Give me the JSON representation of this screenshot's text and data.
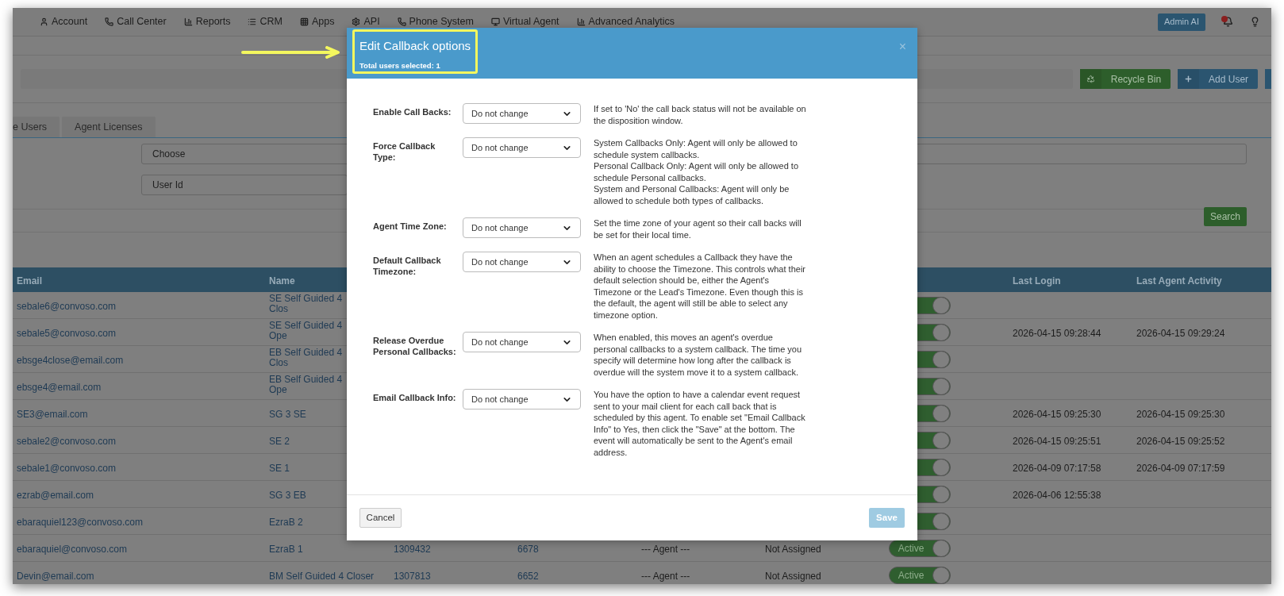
{
  "nav": {
    "items": [
      {
        "label": "Account",
        "kind": "user"
      },
      {
        "label": "Call Center",
        "kind": "phone"
      },
      {
        "label": "Reports",
        "kind": "chart"
      },
      {
        "label": "CRM",
        "kind": "list"
      },
      {
        "label": "Apps",
        "kind": "grid"
      },
      {
        "label": "API",
        "kind": "gear"
      },
      {
        "label": "Phone System",
        "kind": "phone"
      },
      {
        "label": "Virtual Agent",
        "kind": "monitor"
      },
      {
        "label": "Advanced Analytics",
        "kind": "chart"
      }
    ],
    "admin_button": "Admin AI"
  },
  "toolbar": {
    "buttons": [
      {
        "label": "Recycle Bin",
        "kind": "recycle"
      },
      {
        "label": "Add User",
        "kind": "add"
      }
    ]
  },
  "tabs": [
    {
      "label": "e Users",
      "selected": false
    },
    {
      "label": "Agent Licenses",
      "selected": false
    }
  ],
  "filters": {
    "select": "Choose",
    "field": "User Id",
    "search_button": "Search"
  },
  "table": {
    "columns": [
      {
        "label": "Email",
        "kind": "email"
      },
      {
        "label": "Name",
        "kind": "name"
      },
      {
        "label": "Last Login",
        "kind": "last_login"
      },
      {
        "label": "Last Agent Activity",
        "kind": "last_activity"
      }
    ],
    "rows": [
      {
        "email": "sebale6@convoso.com",
        "name": "SE Self Guided 4 Clos",
        "status_on": true
      },
      {
        "email": "sebale5@convoso.com",
        "name": "SE Self Guided 4 Ope",
        "status_on": true,
        "last_login": "2026-04-15 09:28:44",
        "last_activity": "2026-04-15 09:29:24"
      },
      {
        "email": "ebsge4close@email.com",
        "name": "EB Self Guided 4 Clos",
        "status_on": true
      },
      {
        "email": "ebsge4@email.com",
        "name": "EB Self Guided 4 Ope",
        "status_on": true
      },
      {
        "email": "SE3@email.com",
        "name": "SG 3 SE",
        "status_on": true,
        "last_login": "2026-04-15 09:25:30",
        "last_activity": "2026-04-15 09:25:30"
      },
      {
        "email": "sebale2@convoso.com",
        "name": "SE 2",
        "status_on": true,
        "last_login": "2026-04-15 09:25:51",
        "last_activity": "2026-04-15 09:25:52"
      },
      {
        "email": "sebale1@convoso.com",
        "name": "SE 1",
        "status_on": true,
        "last_login": "2026-04-09 07:17:58",
        "last_activity": "2026-04-09 07:17:59"
      },
      {
        "email": "ezrab@email.com",
        "name": "SG 3 EB",
        "status_on": true,
        "last_login": "2026-04-06 12:55:38"
      },
      {
        "email": "ebaraquiel123@convoso.com",
        "name": "EzraB 2",
        "status_on": true
      },
      {
        "email": "ebaraquiel@convoso.com",
        "name": "EzraB 1",
        "user_id": "1309432",
        "extension": "6678",
        "role": "--- Agent ---",
        "assignment": "Not Assigned",
        "status_label": "Active",
        "status_on": true
      },
      {
        "email": "Devin@email.com",
        "name": "BM Self Guided 4 Closer",
        "user_id": "1307813",
        "extension": "6652",
        "role": "--- Agent ---",
        "assignment": "Not Assigned",
        "status_label": "Active",
        "status_on": true
      }
    ]
  },
  "modal": {
    "title": "Edit Callback options",
    "subtitle": "Total users selected: 1",
    "close": "×",
    "settings": [
      {
        "label": "Enable Call Backs:",
        "value": "Do not change",
        "description": [
          "If set to 'No' the call back status will not be available on the disposition window."
        ]
      },
      {
        "label": "Force Callback Type:",
        "value": "Do not change",
        "description": [
          "System Callbacks Only: Agent will only be allowed to schedule system callbacks.",
          "Personal Callback Only: Agent will only be allowed to schedule Personal callbacks.",
          "System and Personal Callbacks: Agent will only be allowed to schedule both types of callbacks."
        ]
      },
      {
        "label": "Agent Time Zone:",
        "value": "Do not change",
        "description": [
          "Set the time zone of your agent so their call backs will be set for their local time."
        ]
      },
      {
        "label": "Default Callback Timezone:",
        "value": "Do not change",
        "description": [
          "When an agent schedules a Callback they have the ability to choose the Timezone. This controls what their default selection should be, either the Agent's Timezone or the Lead's Timezone. Even though this is the default, the agent will still be able to select any timezone option."
        ]
      },
      {
        "label": "Release Overdue Personal Callbacks:",
        "value": "Do not change",
        "description": [
          "When enabled, this moves an agent's overdue personal callbacks to a system callback. The time you specify will determine how long after the callback is overdue will the system move it to a system callback."
        ]
      },
      {
        "label": "Email Callback Info:",
        "value": "Do not change",
        "description": [
          "You have the option to have a calendar event request sent to your mail client for each call back that is scheduled by this agent. To enable set \"Email Callback Info\" to Yes, then click the \"Save\" at the bottom. The event will automatically be sent to the Agent's email address."
        ]
      }
    ],
    "cancel": "Cancel",
    "save": {
      "label": "Save",
      "disabled": true
    }
  }
}
